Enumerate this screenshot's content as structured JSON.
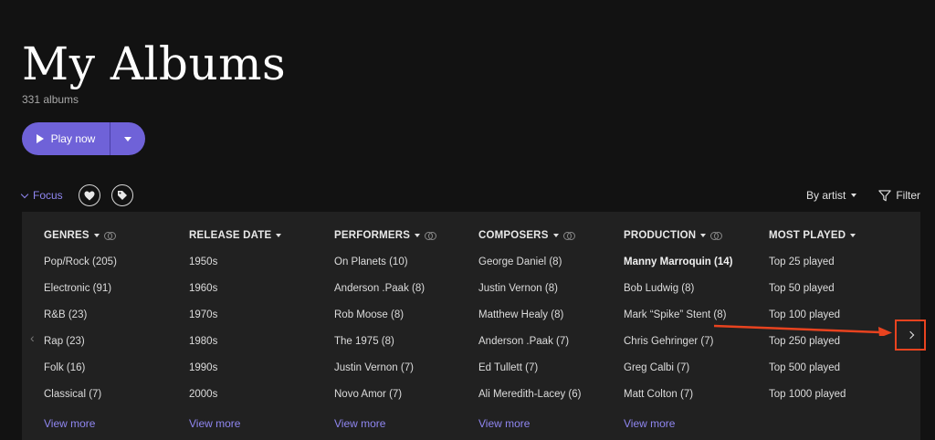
{
  "header": {
    "title": "My Albums",
    "count": "331 albums"
  },
  "play": {
    "label": "Play now"
  },
  "focus": {
    "label": "Focus"
  },
  "sort": {
    "label": "By artist",
    "filter_label": "Filter"
  },
  "columns": [
    {
      "header": "GENRES",
      "items": [
        "Pop/Rock (205)",
        "Electronic (91)",
        "R&B (23)",
        "Rap (23)",
        "Folk (16)",
        "Classical (7)"
      ],
      "view_more": "View more"
    },
    {
      "header": "RELEASE DATE",
      "items": [
        "1950s",
        "1960s",
        "1970s",
        "1980s",
        "1990s",
        "2000s"
      ],
      "view_more": "View more"
    },
    {
      "header": "PERFORMERS",
      "items": [
        "On Planets (10)",
        "Anderson .Paak (8)",
        "Rob Moose (8)",
        "The 1975 (8)",
        "Justin Vernon (7)",
        "Novo Amor (7)"
      ],
      "view_more": "View more"
    },
    {
      "header": "COMPOSERS",
      "items": [
        "George Daniel (8)",
        "Justin Vernon (8)",
        "Matthew Healy (8)",
        "Anderson .Paak (7)",
        "Ed Tullett (7)",
        "Ali Meredith-Lacey (6)"
      ],
      "view_more": "View more"
    },
    {
      "header": "PRODUCTION",
      "items": [
        "Manny Marroquin (14)",
        "Bob Ludwig (8)",
        "Mark “Spike” Stent (8)",
        "Chris Gehringer (7)",
        "Greg Calbi (7)",
        "Matt Colton (7)"
      ],
      "view_more": "View more"
    },
    {
      "header": "MOST PLAYED",
      "items": [
        "Top 25 played",
        "Top 50 played",
        "Top 100 played",
        "Top 250 played",
        "Top 500 played",
        "Top 1000 played"
      ],
      "view_more": ""
    }
  ],
  "colors": {
    "accent": "#6f62d8",
    "link": "#8f86f0",
    "annotation": "#e8431f",
    "background": "#121212",
    "panel": "#212121"
  }
}
